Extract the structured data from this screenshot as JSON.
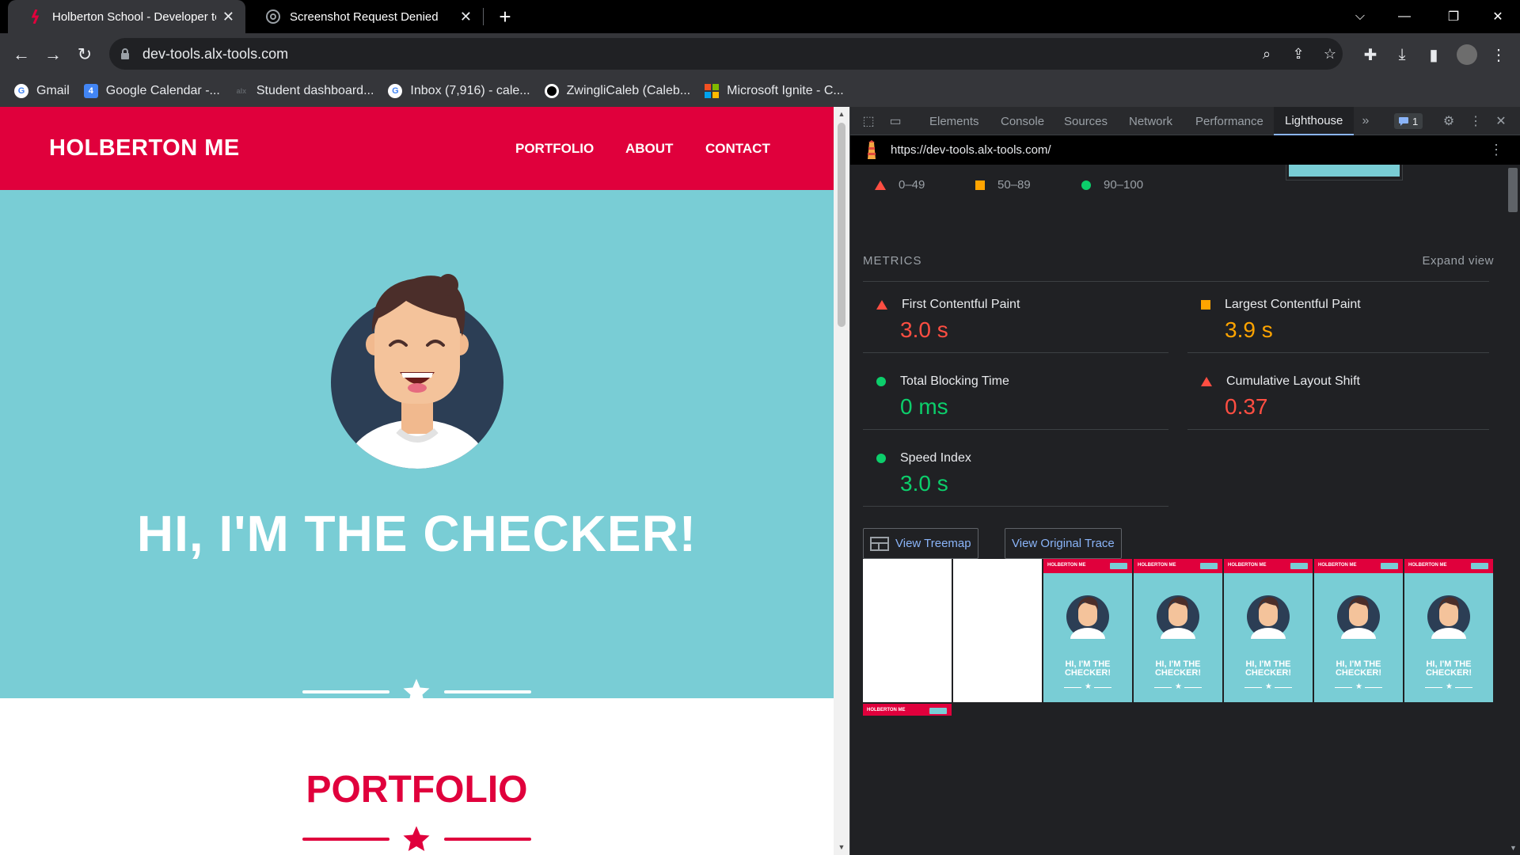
{
  "browser": {
    "tabs": [
      {
        "title": "Holberton School - Developer to",
        "active": true
      },
      {
        "title": "Screenshot Request Denied",
        "active": false
      }
    ],
    "address": "dev-tools.alx-tools.com",
    "bookmarks": [
      {
        "label": "Gmail",
        "icon": "google-icon"
      },
      {
        "label": "Google Calendar -...",
        "icon": "calendar-icon"
      },
      {
        "label": "Student dashboard...",
        "icon": "alx-icon"
      },
      {
        "label": "Inbox (7,916) - cale...",
        "icon": "google-icon"
      },
      {
        "label": "ZwingliCaleb (Caleb...",
        "icon": "github-icon"
      },
      {
        "label": "Microsoft Ignite - C...",
        "icon": "microsoft-icon"
      }
    ]
  },
  "site": {
    "logo": "HOLBERTON ME",
    "nav": [
      "PORTFOLIO",
      "ABOUT",
      "CONTACT"
    ],
    "hero_title": "HI, I'M THE CHECKER!",
    "portfolio_title": "PORTFOLIO",
    "colors": {
      "brand": "#e0003c",
      "hero": "#79cdd5"
    }
  },
  "devtools": {
    "tabs": [
      "Elements",
      "Console",
      "Sources",
      "Network",
      "Performance",
      "Lighthouse"
    ],
    "active_tab": "Lighthouse",
    "issues_count": "1",
    "report_url": "https://dev-tools.alx-tools.com/",
    "legend": [
      {
        "range": "0–49",
        "shape": "triangle",
        "color": "#ff4e42"
      },
      {
        "range": "50–89",
        "shape": "square",
        "color": "#ffa400"
      },
      {
        "range": "90–100",
        "shape": "circle",
        "color": "#0cce6b"
      }
    ],
    "metrics_label": "METRICS",
    "expand_label": "Expand view",
    "metrics": [
      {
        "name": "First Contentful Paint",
        "value": "3.0 s",
        "status": "fail"
      },
      {
        "name": "Largest Contentful Paint",
        "value": "3.9 s",
        "status": "average"
      },
      {
        "name": "Total Blocking Time",
        "value": "0 ms",
        "status": "pass"
      },
      {
        "name": "Cumulative Layout Shift",
        "value": "0.37",
        "status": "fail"
      },
      {
        "name": "Speed Index",
        "value": "3.0 s",
        "status": "pass"
      }
    ],
    "buttons": {
      "treemap": "View Treemap",
      "trace": "View Original Trace"
    },
    "filmstrip": {
      "frame_logo": "HOLBERTON ME",
      "frame_title_line1": "HI, I'M THE",
      "frame_title_line2": "CHECKER!"
    }
  }
}
